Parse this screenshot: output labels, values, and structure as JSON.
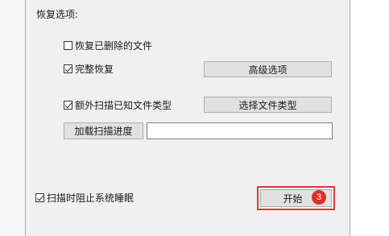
{
  "section": {
    "title": "恢复选项:"
  },
  "options": {
    "recover_deleted": {
      "label": "恢复已删除的文件",
      "checked": false
    },
    "full_recovery": {
      "label": "完整恢复",
      "checked": true
    },
    "extra_scan": {
      "label": "额外扫描已知文件类型",
      "checked": true
    },
    "prevent_sleep": {
      "label": "扫描时阻止系统睡眠",
      "checked": true
    }
  },
  "buttons": {
    "advanced_options": "高级选项",
    "select_file_types": "选择文件类型",
    "load_scan_progress": "加载扫描进度",
    "start": "开始"
  },
  "scan_progress_path": {
    "value": ""
  },
  "annotation": {
    "step_number": "3",
    "highlight_color": "#d93a3a"
  }
}
